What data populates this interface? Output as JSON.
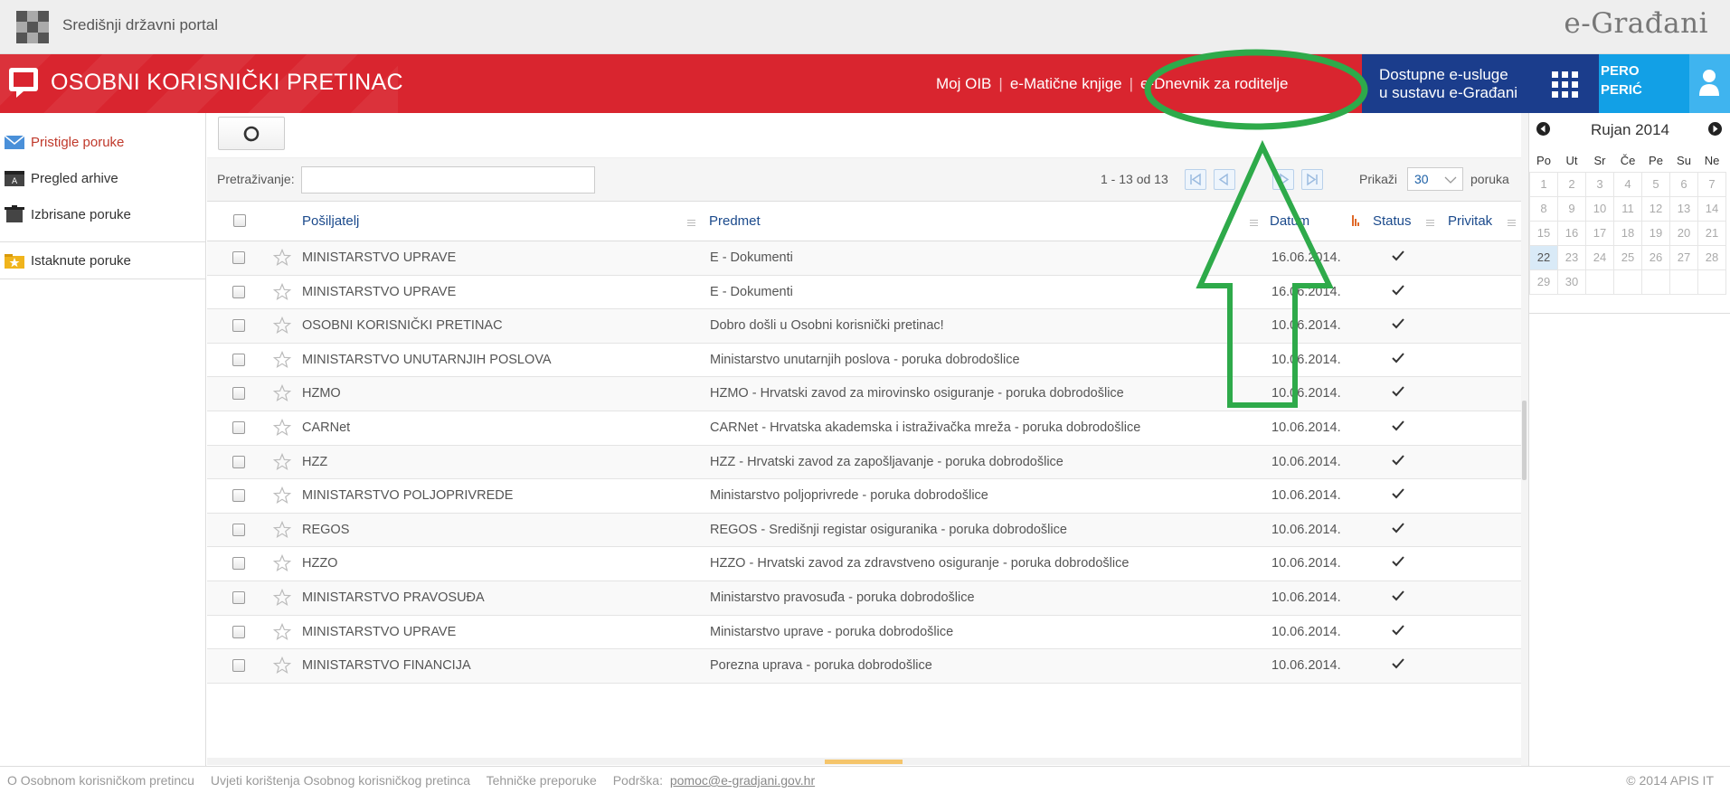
{
  "header": {
    "portal_name": "Središnji državni portal",
    "brand": "e-Građani"
  },
  "redbar": {
    "title": "OSOBNI KORISNIČKI PRETINAC",
    "nav": [
      "Moj OIB",
      "e-Matične knjige",
      "e-Dnevnik za roditelje"
    ],
    "services_line1": "Dostupne e-usluge",
    "services_line2": "u sustavu e-Građani",
    "user_first": "PERO",
    "user_last": "PERIĆ",
    "accent_red": "#d9252f",
    "accent_blue": "#1b3d8c",
    "accent_cyan": "#12a0e6"
  },
  "sidebar": {
    "items": [
      {
        "label": "Pristigle poruke",
        "icon": "envelope-icon"
      },
      {
        "label": "Pregled arhive",
        "icon": "archive-icon"
      },
      {
        "label": "Izbrisane poruke",
        "icon": "trash-icon"
      },
      {
        "label": "Istaknute poruke",
        "icon": "starred-folder-icon"
      }
    ]
  },
  "filter": {
    "search_label": "Pretraživanje:",
    "search_value": "",
    "count": "1 - 13 od 13",
    "show_label": "Prikaži",
    "page_size": "30",
    "unit_label": "poruka"
  },
  "table": {
    "headers": {
      "sender": "Pošiljatelj",
      "subject": "Predmet",
      "date": "Datum",
      "status": "Status",
      "attachment": "Privitak"
    },
    "rows": [
      {
        "sender": "MINISTARSTVO UPRAVE",
        "subject": "E - Dokumenti",
        "date": "16.06.2014.",
        "status": "read"
      },
      {
        "sender": "MINISTARSTVO UPRAVE",
        "subject": "E - Dokumenti",
        "date": "16.06.2014.",
        "status": "read"
      },
      {
        "sender": "OSOBNI KORISNIČKI PRETINAC",
        "subject": "Dobro došli u Osobni korisnički pretinac!",
        "date": "10.06.2014.",
        "status": "read"
      },
      {
        "sender": "MINISTARSTVO UNUTARNJIH POSLOVA",
        "subject": "Ministarstvo unutarnjih poslova - poruka dobrodošlice",
        "date": "10.06.2014.",
        "status": "read"
      },
      {
        "sender": "HZMO",
        "subject": "HZMO - Hrvatski zavod za mirovinsko osiguranje - poruka dobrodošlice",
        "date": "10.06.2014.",
        "status": "read"
      },
      {
        "sender": "CARNet",
        "subject": "CARNet - Hrvatska akademska i istraživačka mreža - poruka dobrodošlice",
        "date": "10.06.2014.",
        "status": "read"
      },
      {
        "sender": "HZZ",
        "subject": "HZZ - Hrvatski zavod za zapošljavanje - poruka dobrodošlice",
        "date": "10.06.2014.",
        "status": "read"
      },
      {
        "sender": "MINISTARSTVO POLJOPRIVREDE",
        "subject": "Ministarstvo poljoprivrede - poruka dobrodošlice",
        "date": "10.06.2014.",
        "status": "read"
      },
      {
        "sender": "REGOS",
        "subject": "REGOS - Središnji registar osiguranika - poruka dobrodošlice",
        "date": "10.06.2014.",
        "status": "read"
      },
      {
        "sender": "HZZO",
        "subject": "HZZO - Hrvatski zavod za zdravstveno osiguranje - poruka dobrodošlice",
        "date": "10.06.2014.",
        "status": "read"
      },
      {
        "sender": "MINISTARSTVO PRAVOSUĐA",
        "subject": "Ministarstvo pravosuđa - poruka dobrodošlice",
        "date": "10.06.2014.",
        "status": "read"
      },
      {
        "sender": "MINISTARSTVO UPRAVE",
        "subject": "Ministarstvo uprave - poruka dobrodošlice",
        "date": "10.06.2014.",
        "status": "read"
      },
      {
        "sender": "MINISTARSTVO FINANCIJA",
        "subject": "Porezna uprava - poruka dobrodošlice",
        "date": "10.06.2014.",
        "status": "read"
      }
    ]
  },
  "calendar": {
    "month": "Rujan 2014",
    "weekdays": [
      "Po",
      "Ut",
      "Sr",
      "Če",
      "Pe",
      "Su",
      "Ne"
    ],
    "weeks": [
      [
        "1",
        "2",
        "3",
        "4",
        "5",
        "6",
        "7"
      ],
      [
        "8",
        "9",
        "10",
        "11",
        "12",
        "13",
        "14"
      ],
      [
        "15",
        "16",
        "17",
        "18",
        "19",
        "20",
        "21"
      ],
      [
        "22",
        "23",
        "24",
        "25",
        "26",
        "27",
        "28"
      ],
      [
        "29",
        "30",
        "",
        "",
        "",
        "",
        ""
      ]
    ],
    "today": "22"
  },
  "footer": {
    "links": [
      "O Osobnom korisničkom pretincu",
      "Uvjeti korištenja Osobnog korisničkog pretinca",
      "Tehničke preporuke",
      "Podrška:"
    ],
    "support_email": "pomoc@e-gradjani.gov.hr",
    "copyright": "© 2014 APIS IT"
  },
  "annotation": {
    "color": "#2eaa4a"
  }
}
